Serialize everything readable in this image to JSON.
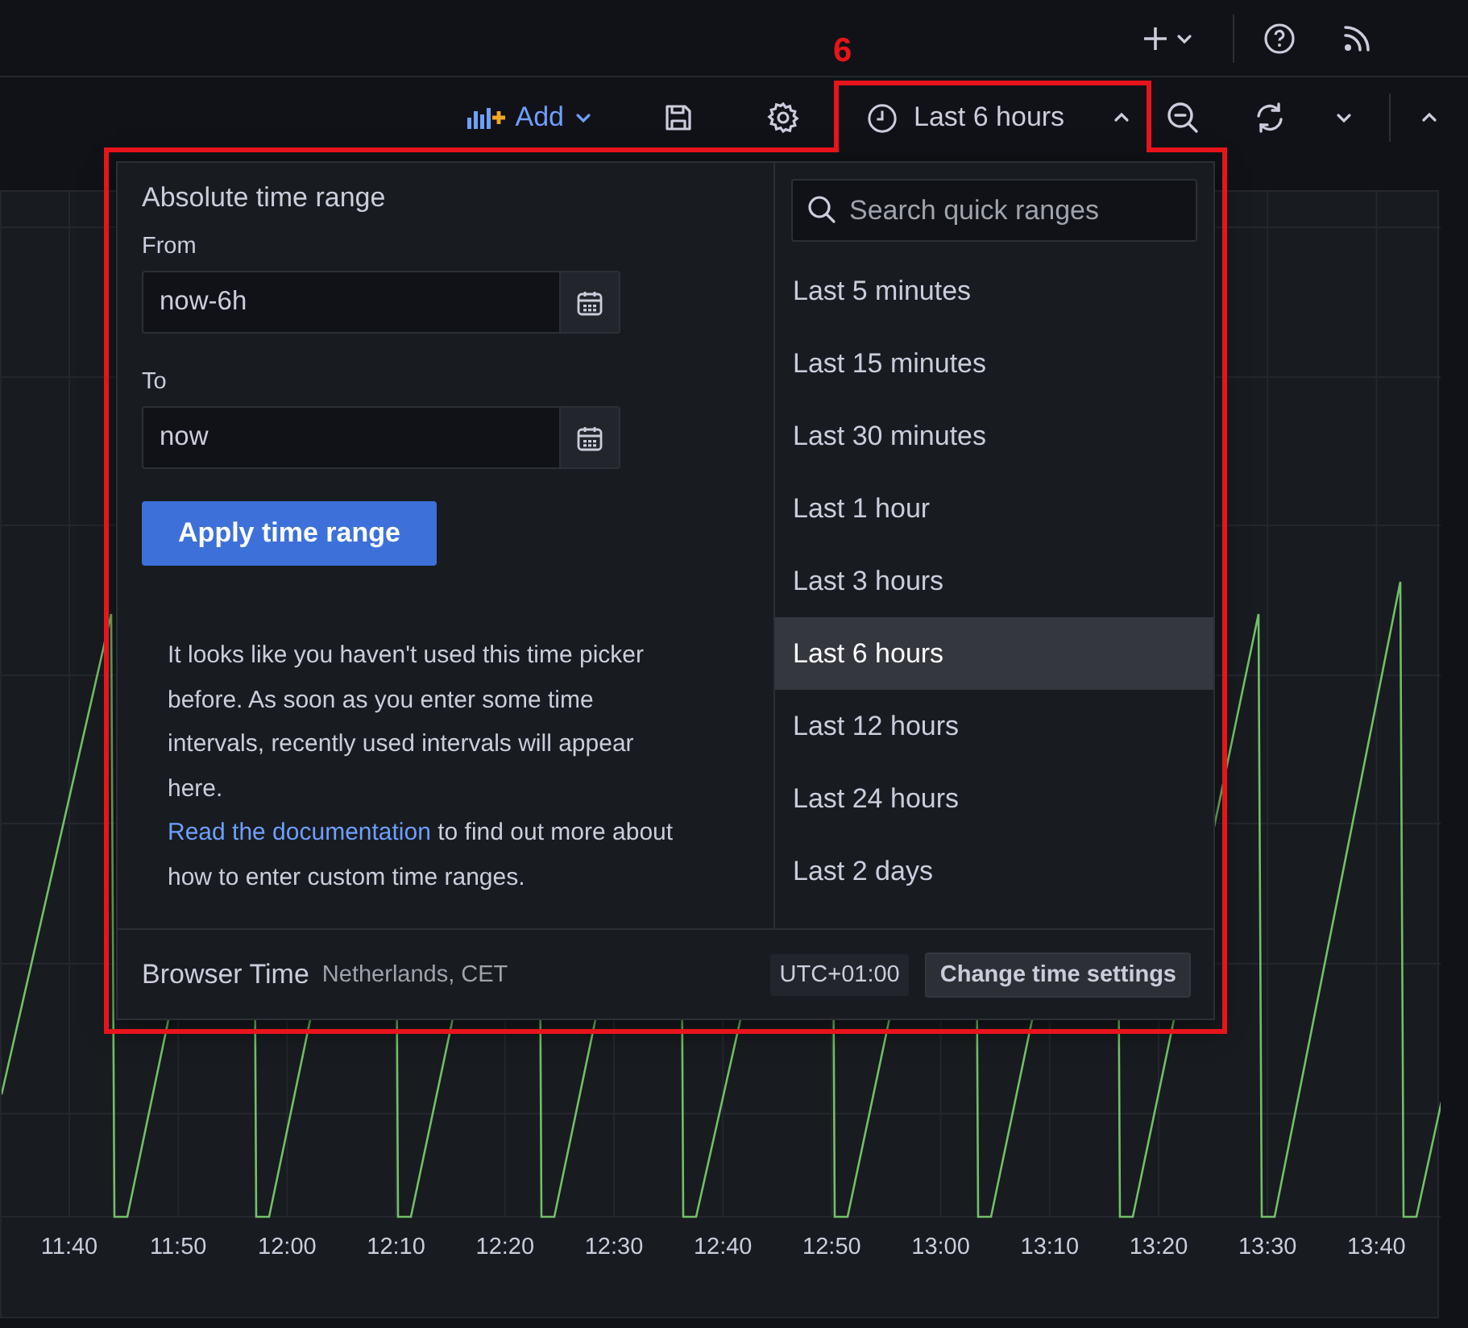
{
  "toolbar": {
    "add_button": {
      "label": "Add"
    },
    "time_picker_button": {
      "label": "Last 6 hours",
      "expanded": true
    }
  },
  "annotation": {
    "label": "6"
  },
  "time_picker": {
    "absolute": {
      "title": "Absolute time range",
      "from": {
        "label": "From",
        "value": "now-6h"
      },
      "to": {
        "label": "To",
        "value": "now"
      },
      "apply_button": "Apply time range"
    },
    "notice": {
      "text": "It looks like you haven't used this time picker before. As soon as you enter some time intervals, recently used intervals will appear here.",
      "link": "Read the documentation",
      "text_after": " to find out more about how to enter custom time ranges."
    },
    "search": {
      "placeholder": "Search quick ranges"
    },
    "quick_ranges": [
      {
        "label": "Last 5 minutes",
        "selected": false
      },
      {
        "label": "Last 15 minutes",
        "selected": false
      },
      {
        "label": "Last 30 minutes",
        "selected": false
      },
      {
        "label": "Last 1 hour",
        "selected": false
      },
      {
        "label": "Last 3 hours",
        "selected": false
      },
      {
        "label": "Last 6 hours",
        "selected": true
      },
      {
        "label": "Last 12 hours",
        "selected": false
      },
      {
        "label": "Last 24 hours",
        "selected": false
      },
      {
        "label": "Last 2 days",
        "selected": false
      }
    ],
    "footer": {
      "timezone_label": "Browser Time",
      "timezone_detail": "Netherlands, CET",
      "utc_offset": "UTC+01:00",
      "change_button": "Change time settings"
    }
  },
  "chart": {
    "x_tick_labels": [
      "11:40",
      "11:50",
      "12:00",
      "12:10",
      "12:20",
      "12:30",
      "12:40",
      "12:50",
      "13:00",
      "13:10",
      "13:20",
      "13:30",
      "13:40"
    ]
  }
}
